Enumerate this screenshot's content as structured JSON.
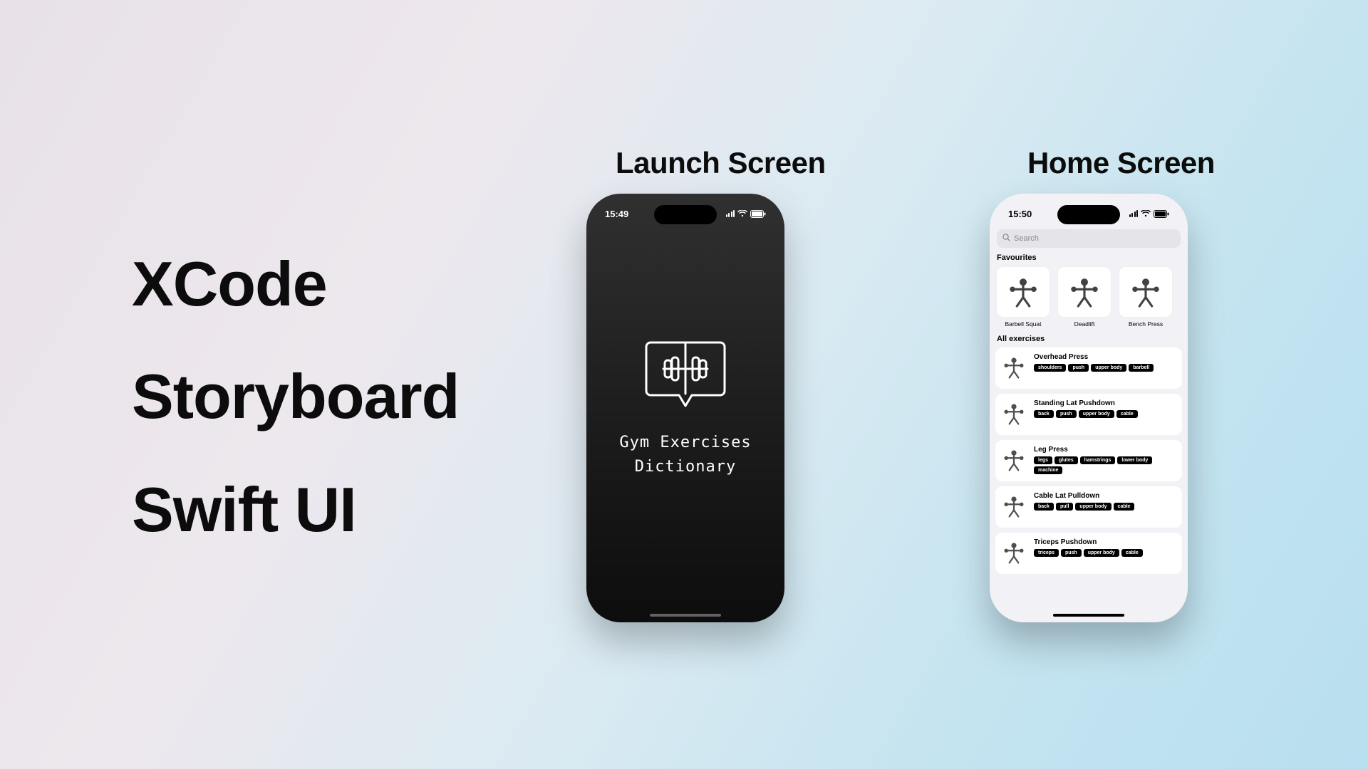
{
  "left": {
    "line1": "XCode",
    "line2": "Storyboard",
    "line3": "Swift UI"
  },
  "labels": {
    "launch": "Launch Screen",
    "home": "Home Screen"
  },
  "launch": {
    "time": "15:49",
    "title": "Gym Exercises\nDictionary"
  },
  "home": {
    "time": "15:50",
    "search_placeholder": "Search",
    "favourites_title": "Favourites",
    "favourites": [
      {
        "name": "Barbell Squat"
      },
      {
        "name": "Deadlift"
      },
      {
        "name": "Bench Press"
      }
    ],
    "all_title": "All exercises",
    "exercises": [
      {
        "name": "Overhead Press",
        "tags": [
          "shoulders",
          "push",
          "upper body",
          "barbell"
        ]
      },
      {
        "name": "Standing Lat Pushdown",
        "tags": [
          "back",
          "push",
          "upper body",
          "cable"
        ]
      },
      {
        "name": "Leg Press",
        "tags": [
          "legs",
          "glutes",
          "hamstrings",
          "lower body",
          "machine"
        ]
      },
      {
        "name": "Cable Lat Pulldown",
        "tags": [
          "back",
          "pull",
          "upper body",
          "cable"
        ]
      },
      {
        "name": "Triceps Pushdown",
        "tags": [
          "triceps",
          "push",
          "upper body",
          "cable"
        ]
      }
    ]
  }
}
